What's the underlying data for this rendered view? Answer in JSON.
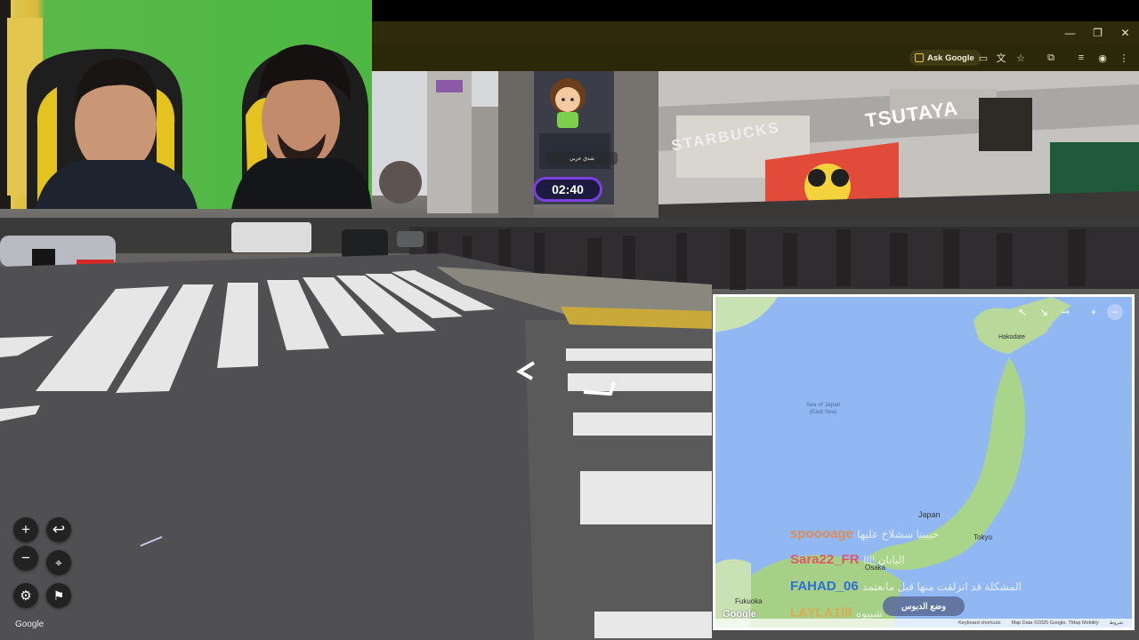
{
  "browser": {
    "ask_google_label": "Ask Google",
    "window_controls": [
      "—",
      "❐",
      "✕"
    ]
  },
  "game": {
    "timer": "02:40",
    "player_chip": "شدق عربي"
  },
  "street_view": {
    "branding": "Google",
    "signs": {
      "tsutaya": "TSUTAYA",
      "starbucks": "STARBUCKS"
    }
  },
  "map": {
    "sea_label_line1": "Sea of Japan",
    "sea_label_line2": "(East Sea)",
    "labels": {
      "hakodate": "Hakodate",
      "japan": "Japan",
      "tokyo": "Tokyo",
      "osaka": "Osaka",
      "fukuoka": "Fukuoka"
    },
    "google_logo": "Google",
    "guess_button": "وضع الدبوس",
    "footer": [
      "Keyboard shortcuts",
      "Map Data ©2025 Google, TMap Mobility",
      "شروط"
    ]
  },
  "chat": [
    {
      "name": "spoooage",
      "message": "حبيبنا سشلاخ عليها",
      "color": "#e8873a"
    },
    {
      "name": "Sara22_FR",
      "message": "!!!! اليابان",
      "color": "#e0596a"
    },
    {
      "name": "FAHAD_06",
      "message": "المشكلة قد انزلقت منها قبل مانعتمد",
      "color": "#2f6ed8"
    },
    {
      "name": "LAYLA1lll",
      "message": "شبيوه",
      "color": "#e8a54a"
    }
  ]
}
